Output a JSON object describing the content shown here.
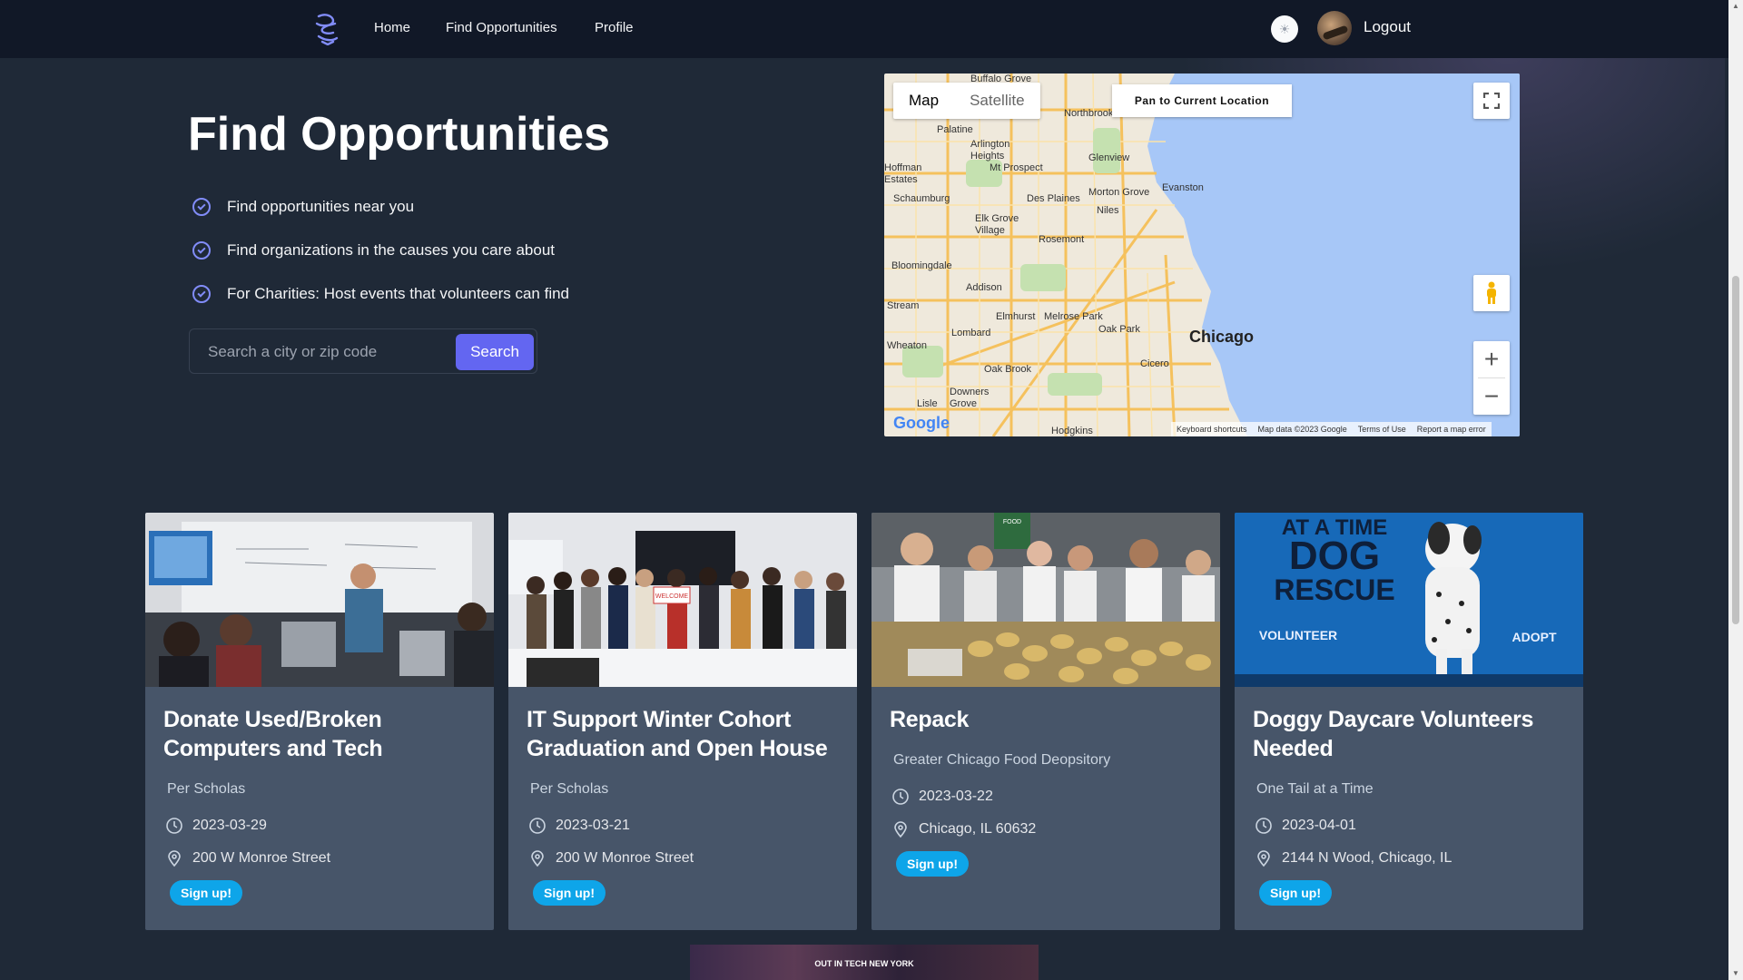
{
  "nav": {
    "home": "Home",
    "find": "Find Opportunities",
    "profile": "Profile",
    "logout": "Logout"
  },
  "hero": {
    "title": "Find Opportunities",
    "features": [
      "Find opportunities near you",
      "Find organizations in the causes you care about",
      "For Charities: Host events that volunteers can find"
    ],
    "search_placeholder": "Search a city or zip code",
    "search_button": "Search"
  },
  "map": {
    "type_map": "Map",
    "type_satellite": "Satellite",
    "pan_button": "Pan to Current Location",
    "city_label": "Chicago",
    "labels": [
      "Buffalo Grove",
      "Northbrook",
      "Palatine",
      "Arlington Heights",
      "Mt Prospect",
      "Glenview",
      "Hoffman Estates",
      "Schaumburg",
      "Des Plaines",
      "Morton Grove",
      "Evanston",
      "Niles",
      "Elk Grove Village",
      "Rosemont",
      "Bloomingdale",
      "Addison",
      "Elmhurst",
      "Melrose Park",
      "Oak Park",
      "Stream",
      "Lombard",
      "Wheaton",
      "Oak Brook",
      "Cicero",
      "Downers Grove",
      "Lisle",
      "Hodgkins"
    ],
    "footer": [
      "Keyboard shortcuts",
      "Map data ©2023 Google",
      "Terms of Use",
      "Report a map error"
    ],
    "google": "Google"
  },
  "cards": [
    {
      "title": "Donate Used/Broken Computers and Tech",
      "org": "Per Scholas",
      "date": "2023-03-29",
      "location": "200 W Monroe Street",
      "signup": "Sign up!"
    },
    {
      "title": "IT Support Winter Cohort Graduation and Open House",
      "org": "Per Scholas",
      "date": "2023-03-21",
      "location": "200 W Monroe Street",
      "signup": "Sign up!"
    },
    {
      "title": "Repack",
      "org": "Greater Chicago Food Deopsitory",
      "date": "2023-03-22",
      "location": "Chicago, IL 60632",
      "signup": "Sign up!"
    },
    {
      "title": "Doggy Daycare Volunteers Needed",
      "org": "One Tail at a Time",
      "date": "2023-04-01",
      "location": "2144 N Wood, Chicago, IL",
      "signup": "Sign up!"
    }
  ],
  "card5_banner": "OUT IN TECH NEW YORK",
  "image_texts": {
    "dog_banner_1": "AT A TIME",
    "dog_banner_2": "DOG",
    "dog_banner_3": "RESCUE",
    "dog_banner_4": "VOLUNTEER",
    "dog_banner_5": "ADOPT",
    "welcome_sign": "WELCOME",
    "food_sign": "FOOD"
  }
}
